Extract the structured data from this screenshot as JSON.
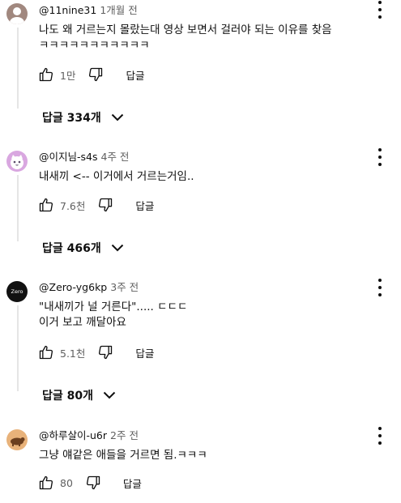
{
  "comments": [
    {
      "author": "@11nine31",
      "time": "1개월 전",
      "text": "나도 왜 거르는지 몰랐는대 영상 보면서 걸러야 되는 이유를 찾음 ㅋㅋㅋㅋㅋㅋㅋㅋㅋㅋㅋ",
      "likes": "1만",
      "reply_label": "답글",
      "replies_label": "답글 334개",
      "avatar_color": "#a1887f"
    },
    {
      "author": "@이지님-s4s",
      "time": "4주 전",
      "text": "내새끼 <-- 이거에서 거르는거임..",
      "likes": "7.6천",
      "reply_label": "답글",
      "replies_label": "답글 466개",
      "avatar_color": "#d9a7e0"
    },
    {
      "author": "@Zero-yg6kp",
      "time": "3주 전",
      "text": "\"내새끼가 널 거른다\"..... ㄷㄷㄷ\n이거 보고 깨달아요",
      "likes": "5.1천",
      "reply_label": "답글",
      "replies_label": "답글 80개",
      "avatar_label": "Zero",
      "avatar_color": "#111111"
    },
    {
      "author": "@하루살이-u6r",
      "time": "2주 전",
      "text": "그냥 얘같은 애들을 거르면 됨.ㅋㅋㅋ",
      "likes": "80",
      "reply_label": "답글",
      "avatar_color": "#e8b27a"
    }
  ],
  "icons": {
    "like": "thumb-up-icon",
    "dislike": "thumb-down-icon",
    "menu": "more-vert-icon",
    "expand": "chevron-down-icon"
  }
}
